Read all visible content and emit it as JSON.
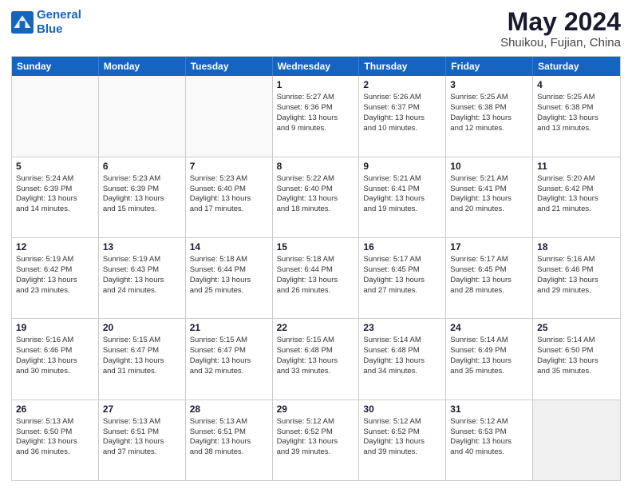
{
  "logo": {
    "line1": "General",
    "line2": "Blue"
  },
  "title": "May 2024",
  "subtitle": "Shuikou, Fujian, China",
  "weekdays": [
    "Sunday",
    "Monday",
    "Tuesday",
    "Wednesday",
    "Thursday",
    "Friday",
    "Saturday"
  ],
  "rows": [
    [
      {
        "day": "",
        "lines": [],
        "empty": true
      },
      {
        "day": "",
        "lines": [],
        "empty": true
      },
      {
        "day": "",
        "lines": [],
        "empty": true
      },
      {
        "day": "1",
        "lines": [
          "Sunrise: 5:27 AM",
          "Sunset: 6:36 PM",
          "Daylight: 13 hours",
          "and 9 minutes."
        ]
      },
      {
        "day": "2",
        "lines": [
          "Sunrise: 5:26 AM",
          "Sunset: 6:37 PM",
          "Daylight: 13 hours",
          "and 10 minutes."
        ]
      },
      {
        "day": "3",
        "lines": [
          "Sunrise: 5:25 AM",
          "Sunset: 6:38 PM",
          "Daylight: 13 hours",
          "and 12 minutes."
        ]
      },
      {
        "day": "4",
        "lines": [
          "Sunrise: 5:25 AM",
          "Sunset: 6:38 PM",
          "Daylight: 13 hours",
          "and 13 minutes."
        ]
      }
    ],
    [
      {
        "day": "5",
        "lines": [
          "Sunrise: 5:24 AM",
          "Sunset: 6:39 PM",
          "Daylight: 13 hours",
          "and 14 minutes."
        ]
      },
      {
        "day": "6",
        "lines": [
          "Sunrise: 5:23 AM",
          "Sunset: 6:39 PM",
          "Daylight: 13 hours",
          "and 15 minutes."
        ]
      },
      {
        "day": "7",
        "lines": [
          "Sunrise: 5:23 AM",
          "Sunset: 6:40 PM",
          "Daylight: 13 hours",
          "and 17 minutes."
        ]
      },
      {
        "day": "8",
        "lines": [
          "Sunrise: 5:22 AM",
          "Sunset: 6:40 PM",
          "Daylight: 13 hours",
          "and 18 minutes."
        ]
      },
      {
        "day": "9",
        "lines": [
          "Sunrise: 5:21 AM",
          "Sunset: 6:41 PM",
          "Daylight: 13 hours",
          "and 19 minutes."
        ]
      },
      {
        "day": "10",
        "lines": [
          "Sunrise: 5:21 AM",
          "Sunset: 6:41 PM",
          "Daylight: 13 hours",
          "and 20 minutes."
        ]
      },
      {
        "day": "11",
        "lines": [
          "Sunrise: 5:20 AM",
          "Sunset: 6:42 PM",
          "Daylight: 13 hours",
          "and 21 minutes."
        ]
      }
    ],
    [
      {
        "day": "12",
        "lines": [
          "Sunrise: 5:19 AM",
          "Sunset: 6:42 PM",
          "Daylight: 13 hours",
          "and 23 minutes."
        ]
      },
      {
        "day": "13",
        "lines": [
          "Sunrise: 5:19 AM",
          "Sunset: 6:43 PM",
          "Daylight: 13 hours",
          "and 24 minutes."
        ]
      },
      {
        "day": "14",
        "lines": [
          "Sunrise: 5:18 AM",
          "Sunset: 6:44 PM",
          "Daylight: 13 hours",
          "and 25 minutes."
        ]
      },
      {
        "day": "15",
        "lines": [
          "Sunrise: 5:18 AM",
          "Sunset: 6:44 PM",
          "Daylight: 13 hours",
          "and 26 minutes."
        ]
      },
      {
        "day": "16",
        "lines": [
          "Sunrise: 5:17 AM",
          "Sunset: 6:45 PM",
          "Daylight: 13 hours",
          "and 27 minutes."
        ]
      },
      {
        "day": "17",
        "lines": [
          "Sunrise: 5:17 AM",
          "Sunset: 6:45 PM",
          "Daylight: 13 hours",
          "and 28 minutes."
        ]
      },
      {
        "day": "18",
        "lines": [
          "Sunrise: 5:16 AM",
          "Sunset: 6:46 PM",
          "Daylight: 13 hours",
          "and 29 minutes."
        ]
      }
    ],
    [
      {
        "day": "19",
        "lines": [
          "Sunrise: 5:16 AM",
          "Sunset: 6:46 PM",
          "Daylight: 13 hours",
          "and 30 minutes."
        ]
      },
      {
        "day": "20",
        "lines": [
          "Sunrise: 5:15 AM",
          "Sunset: 6:47 PM",
          "Daylight: 13 hours",
          "and 31 minutes."
        ]
      },
      {
        "day": "21",
        "lines": [
          "Sunrise: 5:15 AM",
          "Sunset: 6:47 PM",
          "Daylight: 13 hours",
          "and 32 minutes."
        ]
      },
      {
        "day": "22",
        "lines": [
          "Sunrise: 5:15 AM",
          "Sunset: 6:48 PM",
          "Daylight: 13 hours",
          "and 33 minutes."
        ]
      },
      {
        "day": "23",
        "lines": [
          "Sunrise: 5:14 AM",
          "Sunset: 6:48 PM",
          "Daylight: 13 hours",
          "and 34 minutes."
        ]
      },
      {
        "day": "24",
        "lines": [
          "Sunrise: 5:14 AM",
          "Sunset: 6:49 PM",
          "Daylight: 13 hours",
          "and 35 minutes."
        ]
      },
      {
        "day": "25",
        "lines": [
          "Sunrise: 5:14 AM",
          "Sunset: 6:50 PM",
          "Daylight: 13 hours",
          "and 35 minutes."
        ]
      }
    ],
    [
      {
        "day": "26",
        "lines": [
          "Sunrise: 5:13 AM",
          "Sunset: 6:50 PM",
          "Daylight: 13 hours",
          "and 36 minutes."
        ]
      },
      {
        "day": "27",
        "lines": [
          "Sunrise: 5:13 AM",
          "Sunset: 6:51 PM",
          "Daylight: 13 hours",
          "and 37 minutes."
        ]
      },
      {
        "day": "28",
        "lines": [
          "Sunrise: 5:13 AM",
          "Sunset: 6:51 PM",
          "Daylight: 13 hours",
          "and 38 minutes."
        ]
      },
      {
        "day": "29",
        "lines": [
          "Sunrise: 5:12 AM",
          "Sunset: 6:52 PM",
          "Daylight: 13 hours",
          "and 39 minutes."
        ]
      },
      {
        "day": "30",
        "lines": [
          "Sunrise: 5:12 AM",
          "Sunset: 6:52 PM",
          "Daylight: 13 hours",
          "and 39 minutes."
        ]
      },
      {
        "day": "31",
        "lines": [
          "Sunrise: 5:12 AM",
          "Sunset: 6:53 PM",
          "Daylight: 13 hours",
          "and 40 minutes."
        ]
      },
      {
        "day": "",
        "lines": [],
        "empty": true,
        "shaded": true
      }
    ]
  ]
}
